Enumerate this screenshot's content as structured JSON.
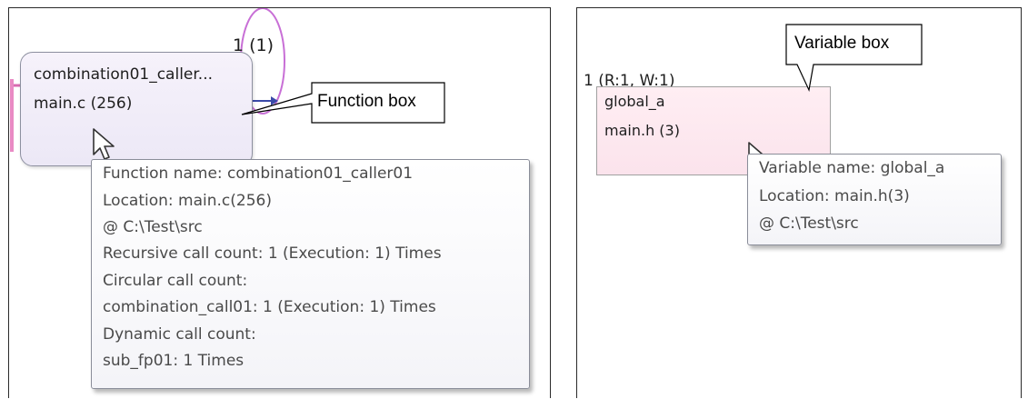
{
  "left_panel": {
    "call_count_label": "1 (1)",
    "function_box": {
      "name": "combination01_caller...",
      "location": "main.c  (256)"
    },
    "callout": "Function box",
    "tooltip": [
      "Function name: combination01_caller01",
      "Location: main.c(256)",
      " @ C:\\Test\\src",
      "Recursive call count: 1 (Execution: 1) Times",
      "Circular call count:",
      " combination_call01: 1 (Execution: 1) Times",
      "Dynamic call count:",
      " sub_fp01: 1 Times"
    ]
  },
  "right_panel": {
    "access_label": "1 (R:1, W:1)",
    "variable_box": {
      "name": "global_a",
      "location": "main.h  (3)"
    },
    "callout": "Variable box",
    "tooltip": [
      "Variable name: global_a",
      "Location: main.h(3)",
      " @ C:\\Test\\src"
    ]
  },
  "colors": {
    "function_box_fill": "#ece8f6",
    "variable_box_fill": "#fbe3ec",
    "recursion_loop": "#c86fd6",
    "tooltip_border": "#8a8d99"
  },
  "icons": [
    "mouse-cursor-icon",
    "recursion-loop-icon",
    "call-arrow-icon"
  ]
}
